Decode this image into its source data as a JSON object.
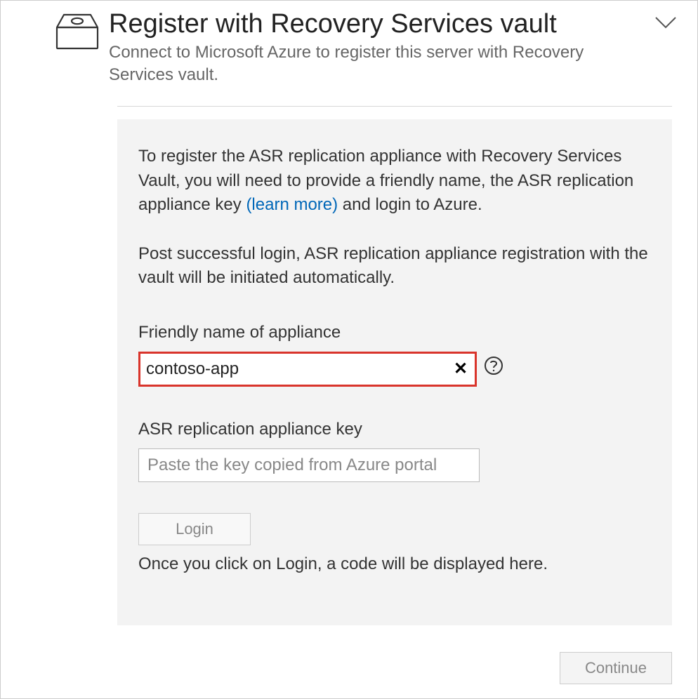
{
  "header": {
    "title": "Register with Recovery Services vault",
    "subtitle": "Connect to Microsoft Azure to register this server with Recovery Services vault."
  },
  "panel": {
    "paragraph1_a": "To register the ASR replication appliance with Recovery Services Vault, you will need to provide a friendly name, the ASR replication appliance key ",
    "learn_more": "(learn more)",
    "paragraph1_b": " and login to Azure.",
    "paragraph2": "Post successful login, ASR replication appliance registration with the vault will be initiated automatically.",
    "friendly_label": "Friendly name of appliance",
    "friendly_value": "contoso-app",
    "clear_glyph": "✕",
    "key_label": "ASR replication appliance key",
    "key_placeholder": "Paste the key copied from Azure portal",
    "key_value": "",
    "login_label": "Login",
    "login_hint": "Once you click on Login, a code will be displayed here."
  },
  "footer": {
    "continue_label": "Continue"
  }
}
